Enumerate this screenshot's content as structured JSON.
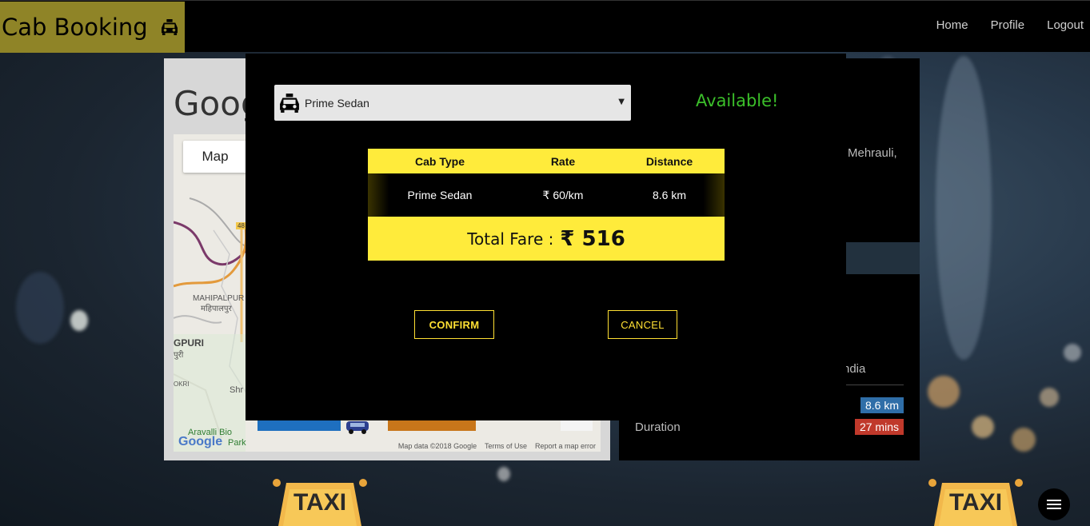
{
  "navbar": {
    "brand": "Cab Booking",
    "brand_icon": "taxi-icon",
    "links": [
      "Home",
      "Profile",
      "Logout"
    ]
  },
  "map_card": {
    "title": "Goog",
    "map_button": "Map",
    "labels": {
      "mahipalpur_en": "MAHIPALPUR",
      "mahipalpur_hi": "महिपालपुर",
      "puri_en": "GPURI",
      "puri_hi": "पुरी",
      "aravalli": "Aravalli Bio",
      "park": "Park",
      "shr": "Shr",
      "okri": "OKRI",
      "road_badge": "48"
    },
    "google_logo": "Google",
    "footer": {
      "map_data": "Map data ©2018 Google",
      "terms": "Terms of Use",
      "report": "Report a map error"
    }
  },
  "info_card": {
    "address_fragment": "Mehrauli,",
    "destination_fragment": "ndia",
    "distance_badge": "8.6 km",
    "duration_label": "Duration",
    "duration_badge": "27 mins"
  },
  "modal": {
    "selected_cab": "Prime Sedan",
    "status": "Available!",
    "table": {
      "headers": [
        "Cab Type",
        "Rate",
        "Distance"
      ],
      "row": [
        "Prime Sedan",
        "₹ 60/km",
        "8.6 km"
      ]
    },
    "total_label": "Total Fare :",
    "total_value": "₹ 516",
    "confirm": "CONFIRM",
    "cancel": "CANCEL"
  },
  "signs": {
    "taxi": "TAXI"
  },
  "colors": {
    "accent_yellow": "#ffeb3b",
    "available_green": "#3bbf2a",
    "brand_bg": "#8f8427",
    "distance_badge": "#2f6ea8",
    "duration_badge": "#c0392b"
  }
}
